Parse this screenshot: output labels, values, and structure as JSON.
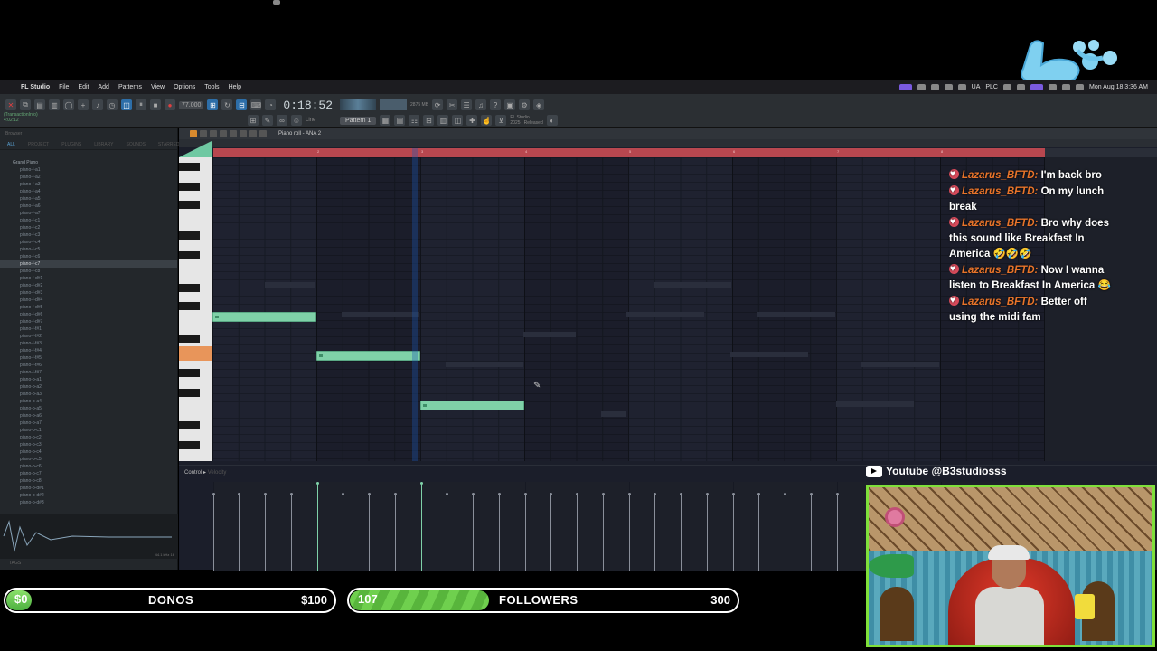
{
  "menubar": {
    "app": "FL Studio",
    "items": [
      "File",
      "Edit",
      "Add",
      "Patterns",
      "View",
      "Options",
      "Tools",
      "Help"
    ],
    "status": {
      "lang": "UA",
      "plc": "PLC",
      "datetime": "Mon Aug 18  3:36 AM"
    }
  },
  "toolbar": {
    "time": "0:18:52",
    "tempo": "77.000",
    "pattern": "Pattern 1",
    "snap": "Line",
    "hint_line1": "(TransactionInfo)",
    "hint_line2": "4:02:12",
    "cpu": "2875 MB",
    "version_line1": "FL Studio",
    "version_line2": "2025 | Released"
  },
  "browser": {
    "header": "Browser",
    "tabs": [
      "ALL",
      "PROJECT",
      "PLUGINS",
      "LIBRARY",
      "SOUNDS",
      "STARRED"
    ],
    "folder": "Grand Piano",
    "items": [
      "piano-f-a1",
      "piano-f-a2",
      "piano-f-a3",
      "piano-f-a4",
      "piano-f-a5",
      "piano-f-a6",
      "piano-f-a7",
      "piano-f-c1",
      "piano-f-c2",
      "piano-f-c3",
      "piano-f-c4",
      "piano-f-c5",
      "piano-f-c6",
      "piano-f-c7",
      "piano-f-c8",
      "piano-f-d#1",
      "piano-f-d#2",
      "piano-f-d#3",
      "piano-f-d#4",
      "piano-f-d#5",
      "piano-f-d#6",
      "piano-f-d#7",
      "piano-f-f#1",
      "piano-f-f#2",
      "piano-f-f#3",
      "piano-f-f#4",
      "piano-f-f#5",
      "piano-f-f#6",
      "piano-f-f#7",
      "piano-p-a1",
      "piano-p-a2",
      "piano-p-a3",
      "piano-p-a4",
      "piano-p-a5",
      "piano-p-a6",
      "piano-p-a7",
      "piano-p-c1",
      "piano-p-c2",
      "piano-p-c3",
      "piano-p-c4",
      "piano-p-c5",
      "piano-p-c6",
      "piano-p-c7",
      "piano-p-c8",
      "piano-p-d#1",
      "piano-p-d#2",
      "piano-p-d#3"
    ],
    "selected_index": 13,
    "wave_info": "44.1 kHz 16",
    "tags": "TAGS"
  },
  "pianoroll": {
    "title": "Piano roll - ANA 2",
    "ruler_numbers": [
      "2",
      "3",
      "4",
      "5",
      "6",
      "7",
      "8"
    ],
    "control_label": "Control",
    "control_value": "Velocity"
  },
  "chat": {
    "messages": [
      {
        "user": "Lazarus_BFTD:",
        "text": "I'm back bro"
      },
      {
        "user": "Lazarus_BFTD:",
        "text": "On my lunch break"
      },
      {
        "user": "Lazarus_BFTD:",
        "text": "Bro why does this sound like Breakfast In America 🤣🤣🤣"
      },
      {
        "user": "Lazarus_BFTD:",
        "text": "Now I wanna listen to Breakfast In America 😂"
      },
      {
        "user": "Lazarus_BFTD:",
        "text": "Better off using the midi fam"
      }
    ]
  },
  "youtube": {
    "label": "Youtube @B3studiosss"
  },
  "goals": {
    "donos": {
      "current": "$0",
      "label": "DONOS",
      "target": "$100",
      "progress": 0
    },
    "followers": {
      "current": "107",
      "label": "FOLLOWERS",
      "target": "300",
      "progress": 0.357
    }
  },
  "colors": {
    "accent_green": "#7fd1a8",
    "ruler_red": "#b8474f",
    "chat_user": "#e8742a",
    "cam_border": "#7fe03a"
  }
}
